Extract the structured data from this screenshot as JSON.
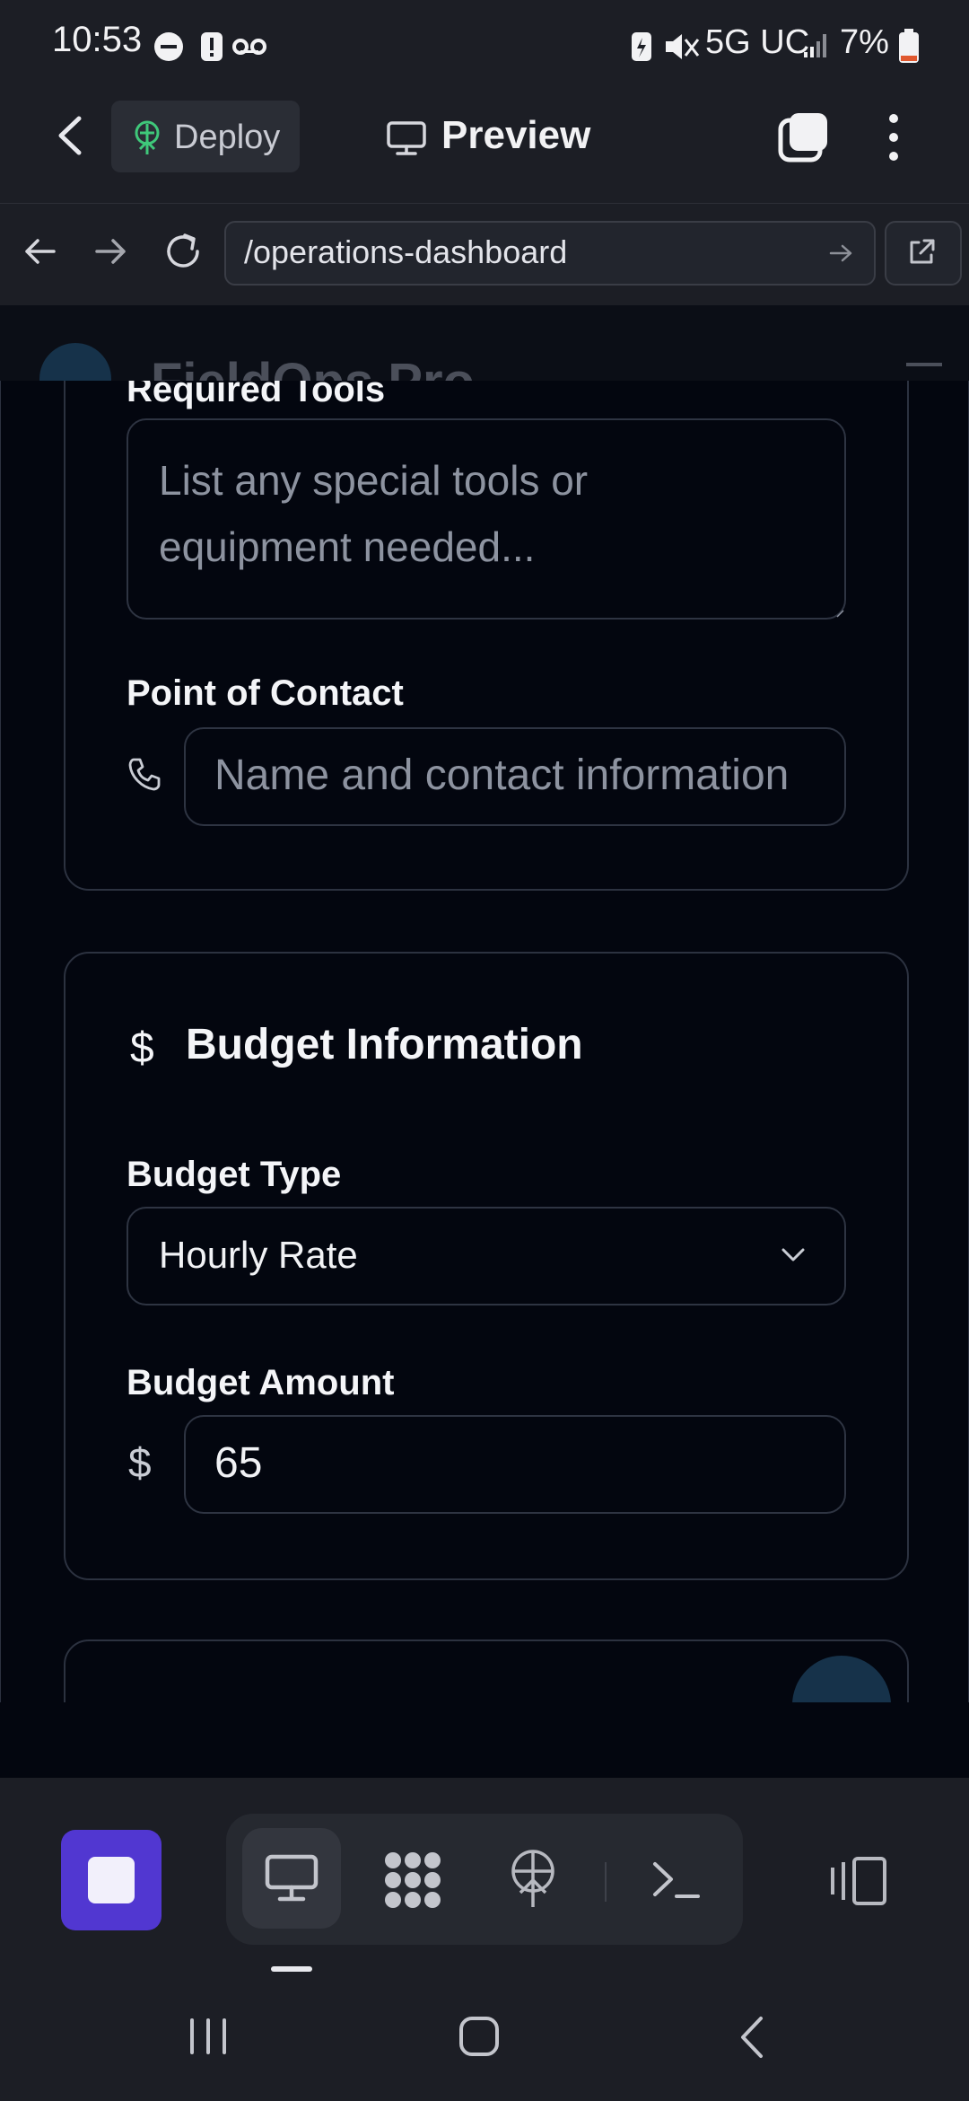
{
  "status_bar": {
    "time": "10:53",
    "network": "5G UC",
    "battery": "7%"
  },
  "app_bar": {
    "deploy_label": "Deploy",
    "preview_label": "Preview"
  },
  "url_bar": {
    "url": "/operations-dashboard"
  },
  "background_page": {
    "app_title": "FieldOps Pro"
  },
  "form": {
    "required_tools": {
      "label": "Required Tools",
      "placeholder_line1": "List any special tools or",
      "placeholder_line2": "equipment needed..."
    },
    "point_of_contact": {
      "label": "Point of Contact",
      "placeholder": "Name and contact information"
    },
    "budget_section": {
      "title": "Budget Information",
      "icon_glyph": "$",
      "budget_type_label": "Budget Type",
      "budget_type_value": "Hourly Rate",
      "budget_amount_label": "Budget Amount",
      "currency_symbol": "$",
      "budget_amount_value": "65"
    }
  },
  "colors": {
    "accent_stop": "#5137d1",
    "deploy_icon": "#3fc87a"
  }
}
